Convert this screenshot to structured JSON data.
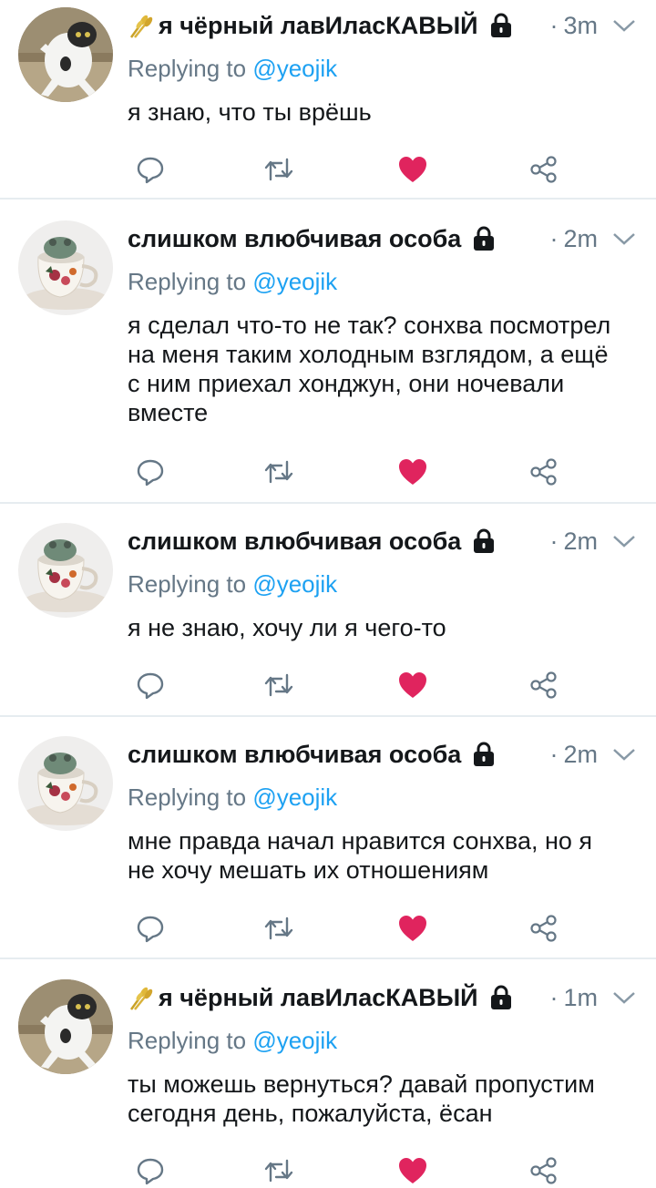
{
  "tweets": [
    {
      "author": "я чёрный лавИласКАВЫЙ",
      "emoji": "wheat-sheaf-icon",
      "protected_icon": "lock-icon",
      "time": "3m",
      "reply_prefix": "Replying to ",
      "reply_handle": "@yeojik",
      "text": "я знаю, что ты врёшь",
      "avatar": "cat-avatar",
      "liked": true
    },
    {
      "author": "слишком влюбчивая особа",
      "emoji": "",
      "protected_icon": "lock-icon",
      "time": "2m",
      "reply_prefix": "Replying to ",
      "reply_handle": "@yeojik",
      "text": "я сделал что-то не так? сонхва посмотрел\nна меня таким холодным взглядом, а ещё\nс ним приехал хонджун, они ночевали\nвместе",
      "avatar": "teacup-frog-avatar",
      "liked": true
    },
    {
      "author": "слишком влюбчивая особа",
      "emoji": "",
      "protected_icon": "lock-icon",
      "time": "2m",
      "reply_prefix": "Replying to ",
      "reply_handle": "@yeojik",
      "text": "я не знаю, хочу ли я чего-то",
      "avatar": "teacup-frog-avatar",
      "liked": true
    },
    {
      "author": "слишком влюбчивая особа",
      "emoji": "",
      "protected_icon": "lock-icon",
      "time": "2m",
      "reply_prefix": "Replying to ",
      "reply_handle": "@yeojik",
      "text": "мне правда начал нравится сонхва, но я\nне хочу мешать их отношениям",
      "avatar": "teacup-frog-avatar",
      "liked": true
    },
    {
      "author": "я чёрный лавИласКАВЫЙ",
      "emoji": "wheat-sheaf-icon",
      "protected_icon": "lock-icon",
      "time": "1m",
      "reply_prefix": "Replying to ",
      "reply_handle": "@yeojik",
      "text": "ты можешь вернуться? давай пропустим\nсегодня день, пожалуйста, ёсан",
      "avatar": "cat-avatar",
      "liked": true
    }
  ],
  "colors": {
    "text": "#14171a",
    "secondary": "#657786",
    "link": "#1da1f2",
    "like": "#e0245e",
    "divider": "#e6ecf0"
  },
  "action_icons": [
    "reply-icon",
    "retweet-icon",
    "like-icon",
    "share-icon"
  ]
}
